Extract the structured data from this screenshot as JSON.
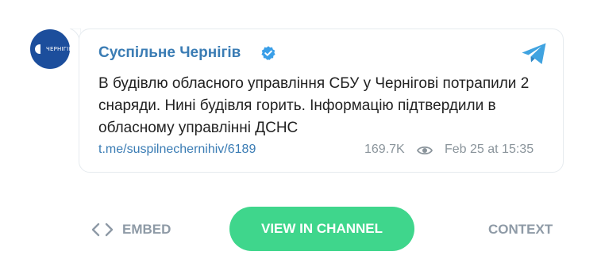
{
  "channel": {
    "name": "Суспільне Чернігів",
    "avatar_text": "ЧЕРНІГІВ",
    "verified_icon": "verified-badge-icon",
    "brand_color": "#1c4e9c"
  },
  "message": {
    "text": "В будівлю обласного управління СБУ у Чернігові потрапили 2 снаряди. Нині будівля горить. Інформацію підтвердили в обласному управлінні ДСНС",
    "link": "t.me/suspilnechernihiv/6189",
    "views": "169.7K",
    "date": "Feb 25 at 15:35"
  },
  "actions": {
    "embed_label": "EMBED",
    "view_label": "VIEW IN CHANNEL",
    "context_label": "CONTEXT",
    "accent": "#3fd68c"
  },
  "icons": [
    "telegram-icon",
    "eye-icon",
    "code-icon",
    "verified-badge-icon"
  ]
}
